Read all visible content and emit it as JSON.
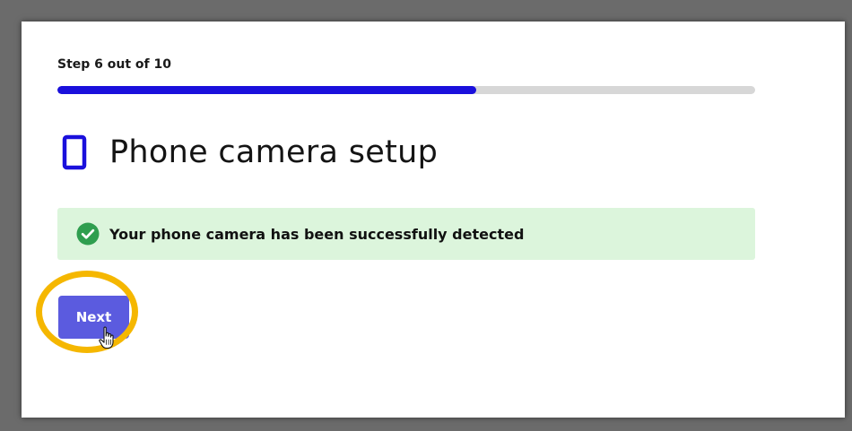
{
  "step": {
    "label": "Step 6 out of 10",
    "current": 6,
    "total": 10,
    "progress_fraction": 0.6
  },
  "header": {
    "icon": "phone-icon",
    "title": "Phone camera setup"
  },
  "status": {
    "icon": "check-circle-icon",
    "message": "Your phone camera has been successfully detected"
  },
  "actions": {
    "next_label": "Next"
  },
  "annotation": {
    "highlight": "highlight-ring",
    "cursor": "hand-pointer-icon"
  },
  "colors": {
    "backdrop": "#6b6b6b",
    "progress_fill": "#1a10dc",
    "progress_track": "#d7d7d7",
    "phone_icon": "#1a10dc",
    "banner_bg": "#dcf5dc",
    "check": "#2f9e4f",
    "button": "#5b5bdf",
    "highlight": "#f5b700"
  }
}
